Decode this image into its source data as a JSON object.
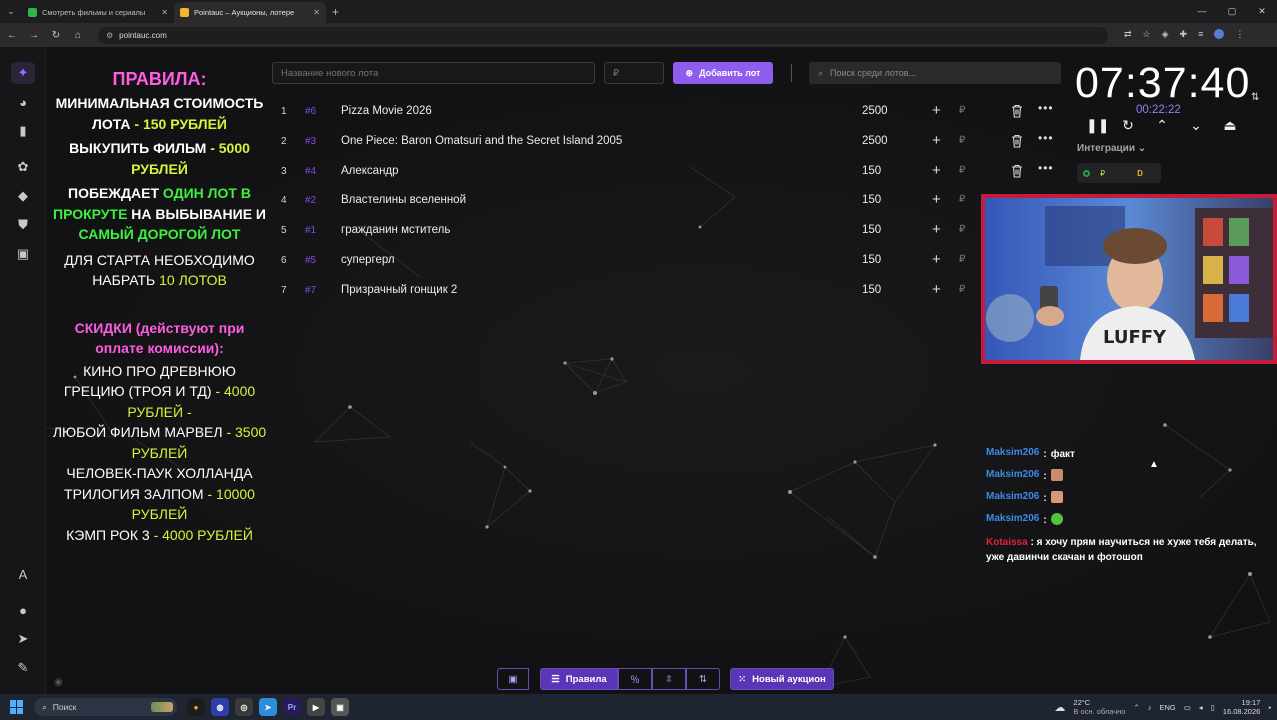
{
  "browser": {
    "tabs": [
      {
        "title": "Смотреть фильмы и сериалы",
        "favicon_color": "#2fb34a",
        "active": false
      },
      {
        "title": "Pointauc – Аукционы, лотере",
        "favicon_color": "#f2b632",
        "active": true
      }
    ],
    "url": "pointauc.com"
  },
  "rules": {
    "title": "ПРАВИЛА:",
    "min_cost_label": "МИНИМАЛЬНАЯ СТОИМОСТЬ ЛОТА",
    "min_cost_value": "- 150 РУБЛЕЙ",
    "buyout_label": "ВЫКУПИТЬ ФИЛЬМ",
    "buyout_value": "- 5000 РУБЛЕЙ",
    "wins_prefix": "ПОБЕЖДАЕТ",
    "wins_one_lot": "ОДИН ЛОТ В ПРОКРУТЕ",
    "wins_mid": "НА ВЫБЫВАНИЕ И",
    "wins_expensive": "САМЫЙ ДОРОГОЙ ЛОТ",
    "start_label": "ДЛЯ СТАРТА НЕОБХОДИМО НАБРАТЬ",
    "start_value": "10 ЛОТОВ",
    "discounts_title": "СКИДКИ (действуют при оплате комиссии):",
    "discounts": [
      {
        "label": "КИНО ПРО ДРЕВНЮЮ ГРЕЦИЮ (ТРОЯ И ТД)",
        "value": "- 4000 РУБЛЕЙ -"
      },
      {
        "label": "ЛЮБОЙ ФИЛЬМ МАРВЕЛ",
        "value": "- 3500 РУБЛЕЙ"
      },
      {
        "label": "ЧЕЛОВЕК-ПАУК ХОЛЛАНДА ТРИЛОГИЯ ЗАЛПОМ",
        "value": "- 10000 РУБЛЕЙ"
      },
      {
        "label": "КЭМП РОК 3",
        "value": "- 4000 РУБЛЕЙ"
      }
    ]
  },
  "toolbar": {
    "lot_name_placeholder": "Название нового лота",
    "price_placeholder": "₽",
    "add_label": "Добавить лот",
    "search_placeholder": "Поиск среди лотов..."
  },
  "lots": [
    {
      "index": "1",
      "id": "#6",
      "name": "Pizza Movie 2026",
      "amount": "2500",
      "deletable": true
    },
    {
      "index": "2",
      "id": "#3",
      "name": "One Piece: Baron Omatsuri and the Secret Island 2005",
      "amount": "2500",
      "deletable": true
    },
    {
      "index": "3",
      "id": "#4",
      "name": "Александр",
      "amount": "150",
      "deletable": true
    },
    {
      "index": "4",
      "id": "#2",
      "name": "Властелины вселенной",
      "amount": "150",
      "deletable": false
    },
    {
      "index": "5",
      "id": "#1",
      "name": "гражданин мститель",
      "amount": "150",
      "deletable": false
    },
    {
      "index": "6",
      "id": "#5",
      "name": "супергерл",
      "amount": "150",
      "deletable": false
    },
    {
      "index": "7",
      "id": "#7",
      "name": "Призрачный гонщик 2",
      "amount": "150",
      "deletable": false
    }
  ],
  "lot_currency": "₽",
  "timer": {
    "main": "07:37:40",
    "sub": "00:22:22"
  },
  "integrations": {
    "label": "Интеграции",
    "currency": "₽",
    "d_label": "D"
  },
  "chat": [
    {
      "user": "Maksim206",
      "sep": ":",
      "text": "факт",
      "color": "#3d8be4",
      "emote": null
    },
    {
      "user": "Maksim206",
      "sep": ":",
      "text": "",
      "color": "#3d8be4",
      "emote": "#c98c6e"
    },
    {
      "user": "Maksim206",
      "sep": ":",
      "text": "",
      "color": "#3d8be4",
      "emote": "#d69a78"
    },
    {
      "user": "Maksim206",
      "sep": ":",
      "text": "",
      "color": "#3d8be4",
      "emote": "#4fc43a"
    },
    {
      "user": "Kotaissa",
      "sep": ":",
      "text": "я хочу прям научиться не хуже тебя делать, уже давинчи скачан и фотошоп",
      "color": "#e1203f",
      "emote": null
    }
  ],
  "bottom": {
    "rules_label": "Правила",
    "new_auction_label": "Новый аукцион"
  },
  "taskbar": {
    "search_label": "Поиск",
    "weather_temp": "22°C",
    "weather_desc": "В осн. облачно",
    "lang": "ENG",
    "time": "19:17",
    "date": "16.08.2026"
  }
}
